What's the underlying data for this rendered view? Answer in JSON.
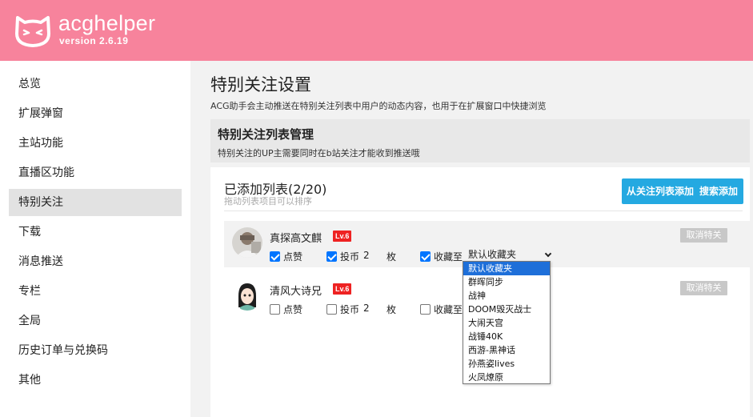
{
  "header": {
    "brand": "acghelper",
    "version": "version 2.6.19"
  },
  "sidebar": {
    "items": [
      {
        "label": "总览"
      },
      {
        "label": "扩展弹窗"
      },
      {
        "label": "主站功能"
      },
      {
        "label": "直播区功能"
      },
      {
        "label": "特别关注",
        "active": true
      },
      {
        "label": "下载"
      },
      {
        "label": "消息推送"
      },
      {
        "label": "专栏"
      },
      {
        "label": "全局"
      },
      {
        "label": "历史订单与兑换码"
      },
      {
        "label": "其他"
      }
    ]
  },
  "main": {
    "title": "特别关注设置",
    "desc": "ACG助手会主动推送在特别关注列表中用户的动态内容，也用于在扩展窗口中快捷浏览",
    "section": {
      "title": "特别关注列表管理",
      "desc": "特别关注的UP主需要同时在b站关注才能收到推送哦"
    },
    "list": {
      "title": "已添加列表(2/20)",
      "hint": "拖动列表项目可以排序",
      "add_from_follow": "从关注列表添加",
      "search_add": "搜索添加"
    },
    "users": [
      {
        "name": "真探高文麒",
        "level": "Lv.6",
        "like_label": "点赞",
        "like_checked": true,
        "coin_label": "投币",
        "coin_checked": true,
        "coin_count": "2",
        "coin_unit": "枚",
        "fav_label": "收藏至",
        "fav_checked": true,
        "folder": "默认收藏夹",
        "cancel": "取消特关"
      },
      {
        "name": "清风大诗兄",
        "level": "Lv.6",
        "like_label": "点赞",
        "like_checked": false,
        "coin_label": "投币",
        "coin_checked": false,
        "coin_count": "2",
        "coin_unit": "枚",
        "fav_label": "收藏至",
        "fav_checked": false,
        "cancel": "取消特关"
      }
    ],
    "folder_options": [
      "默认收藏夹",
      "群晖同步",
      "战神",
      "DOOM毁灭战士",
      "大闹天宫",
      "战锤40K",
      "西游-黑神话",
      "孙燕姿lives",
      "火凤燎原"
    ]
  },
  "colors": {
    "header": "#f7839c",
    "accent": "#24a9e1",
    "level_badge": "#ee2222",
    "checkbox": "#0075ff"
  }
}
